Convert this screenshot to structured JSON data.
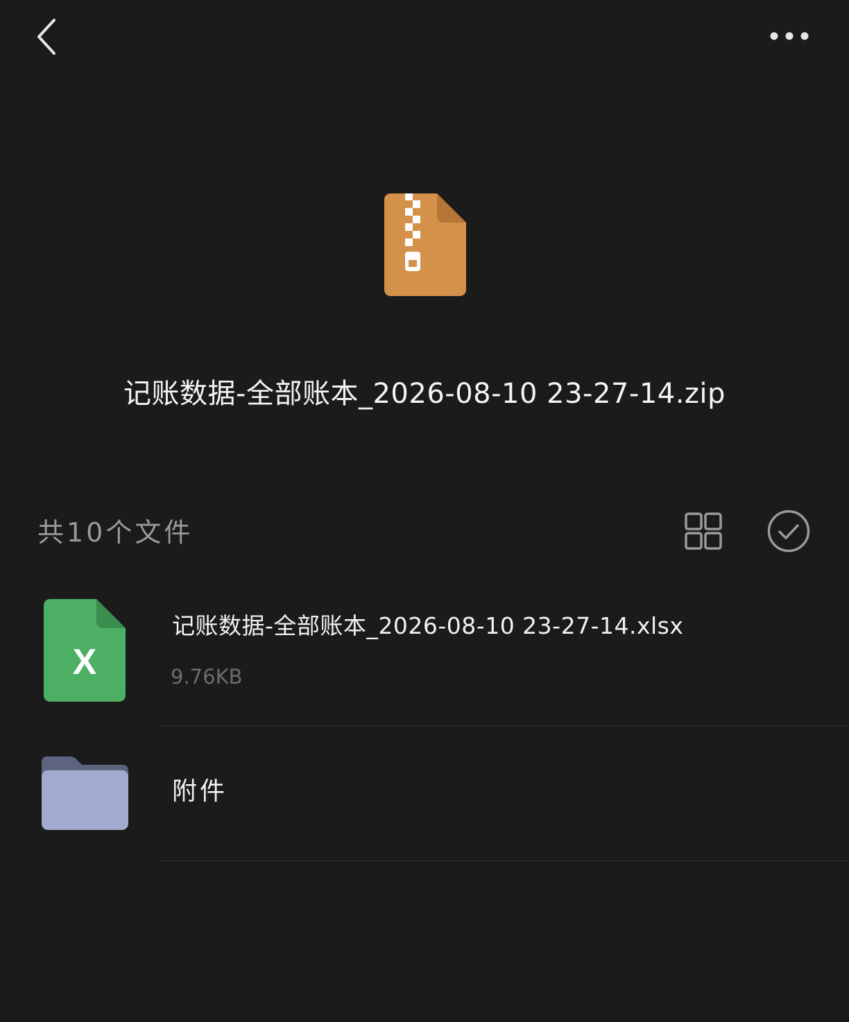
{
  "toolbar": {
    "back_icon": "chevron-left-icon",
    "more_icon": "more-horizontal-icon"
  },
  "archive": {
    "icon": "zip-file-icon",
    "icon_color": "#D4914A",
    "title": "记账数据-全部账本_2026-08-10 23-27-14.zip"
  },
  "list_header": {
    "count_text": "共10个文件",
    "grid_icon": "grid-view-icon",
    "select_icon": "check-circle-icon"
  },
  "files": [
    {
      "name": "记账数据-全部账本_2026-08-10 23-27-14.xlsx",
      "size": "9.76KB",
      "icon": "excel-file-icon",
      "icon_color": "#4CAF63",
      "icon_letter": "X"
    },
    {
      "name": "附件",
      "icon": "folder-icon",
      "icon_color": "#A2AACF"
    }
  ],
  "colors": {
    "background": "#1B1B1B",
    "primary_text": "#F2F2F2",
    "secondary_text": "#9A9A9A",
    "muted_text": "#6C6C6C"
  }
}
